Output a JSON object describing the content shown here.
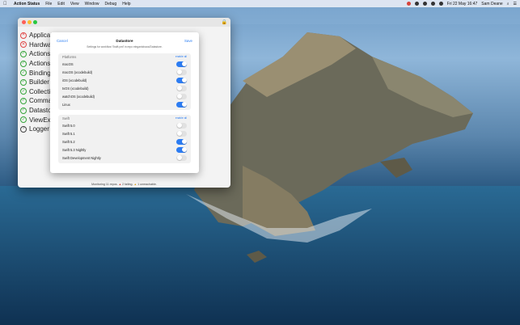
{
  "menubar": {
    "app_name": "Action Status",
    "menus": [
      "File",
      "Edit",
      "View",
      "Window",
      "Debug",
      "Help"
    ],
    "clock": "Fri 22 May  16:47",
    "user": "Sam Deane"
  },
  "window": {
    "actions": [
      {
        "name": "Applicat",
        "status": "failing",
        "glyph": "✕"
      },
      {
        "name": "Hardwar",
        "status": "failing",
        "glyph": "✕"
      },
      {
        "name": "Actions",
        "status": "passing",
        "glyph": "✓"
      },
      {
        "name": "ActionsK",
        "status": "passing",
        "glyph": "✓"
      },
      {
        "name": "Bindings",
        "status": "passing",
        "glyph": "✓"
      },
      {
        "name": "Builder",
        "status": "passing",
        "glyph": "✓"
      },
      {
        "name": "Collectio",
        "status": "passing",
        "glyph": "✓"
      },
      {
        "name": "Comma",
        "status": "passing",
        "glyph": "✓"
      },
      {
        "name": "Datastor",
        "status": "passing",
        "glyph": "✓"
      },
      {
        "name": "ViewExte",
        "status": "passing",
        "glyph": "✓"
      },
      {
        "name": "Logger",
        "status": "unknown",
        "glyph": "?"
      }
    ],
    "footer": {
      "monitoring": "Monitoring 11 repos.",
      "failing": "2 failing.",
      "unreachable": "1 unreachable."
    }
  },
  "sheet": {
    "cancel_label": "Cancel",
    "save_label": "Save",
    "title": "Datastore",
    "subtitle": "Settings for workflow 'Swift.yml' in repo elegantchaos/Datastore.",
    "platforms": {
      "title": "Platforms",
      "enable_all": "enable all",
      "options": [
        {
          "label": "macOS",
          "on": true
        },
        {
          "label": "macOS (xcodebuild)",
          "on": false
        },
        {
          "label": "iOS (xcodebuild)",
          "on": true
        },
        {
          "label": "tvOS (xcodebuild)",
          "on": false
        },
        {
          "label": "watchOS (xcodebuild)",
          "on": false
        },
        {
          "label": "Linux",
          "on": true
        }
      ]
    },
    "swift": {
      "title": "Swift",
      "enable_all": "enable all",
      "options": [
        {
          "label": "Swift 5.0",
          "on": false
        },
        {
          "label": "Swift 5.1",
          "on": false
        },
        {
          "label": "Swift 5.2",
          "on": true
        },
        {
          "label": "Swift 5.3 Nightly",
          "on": true
        },
        {
          "label": "Swift Development Nightly",
          "on": false
        }
      ]
    }
  },
  "colors": {
    "accent": "#2c7cf2",
    "failing": "#e04646",
    "passing": "#36a53a"
  }
}
